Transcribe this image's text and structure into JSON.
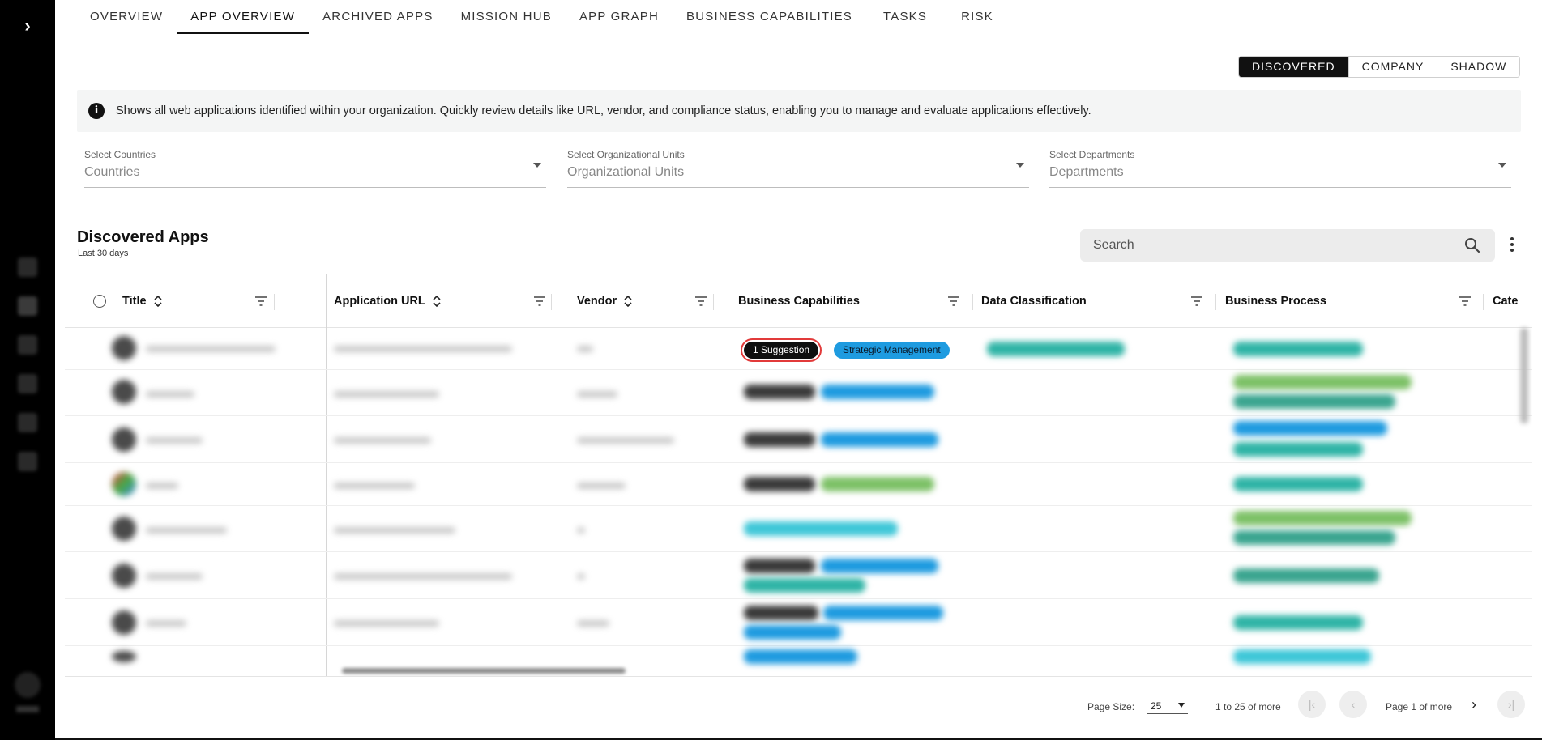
{
  "tabs": [
    {
      "label": "OVERVIEW"
    },
    {
      "label": "APP OVERVIEW"
    },
    {
      "label": "ARCHIVED APPS"
    },
    {
      "label": "MISSION HUB"
    },
    {
      "label": "APP GRAPH"
    },
    {
      "label": "BUSINESS CAPABILITIES"
    },
    {
      "label": "TASKS"
    },
    {
      "label": "RISK"
    }
  ],
  "active_tab": "APP OVERVIEW",
  "segment": {
    "options": [
      {
        "label": "DISCOVERED"
      },
      {
        "label": "COMPANY"
      },
      {
        "label": "SHADOW"
      }
    ],
    "selected": "DISCOVERED"
  },
  "info": {
    "icon": "info-icon",
    "text": "Shows all web applications identified within your organization. Quickly review details like URL, vendor, and compliance status, enabling you to manage and evaluate applications effectively."
  },
  "filters": [
    {
      "label": "Select Countries",
      "placeholder": "Countries"
    },
    {
      "label": "Select Organizational Units",
      "placeholder": "Organizational Units"
    },
    {
      "label": "Select Departments",
      "placeholder": "Departments"
    }
  ],
  "section": {
    "title": "Discovered Apps",
    "subtitle": "Last 30 days"
  },
  "search": {
    "placeholder": "Search",
    "icon": "search-icon"
  },
  "table": {
    "columns": [
      {
        "label": "Title",
        "sortable": true
      },
      {
        "label": "Application URL",
        "sortable": true
      },
      {
        "label": "Vendor",
        "sortable": true
      },
      {
        "label": "Business Capabilities",
        "sortable": false
      },
      {
        "label": "Data Classification",
        "sortable": false
      },
      {
        "label": "Business Process",
        "sortable": false
      },
      {
        "label": "Cate",
        "sortable": false
      }
    ],
    "first_row_tags": {
      "suggestion": "1 Suggestion",
      "capability": "Strategic Management"
    }
  },
  "colors": {
    "accent_dark": "#0f0f0f",
    "capability_blue": "#1e9be0",
    "highlight_red": "#e23a3a",
    "rail_bg": "#000000"
  },
  "pagination": {
    "page_size_label": "Page Size:",
    "page_size": "25",
    "range": "1 to 25 of more",
    "page": "Page 1 of more"
  }
}
